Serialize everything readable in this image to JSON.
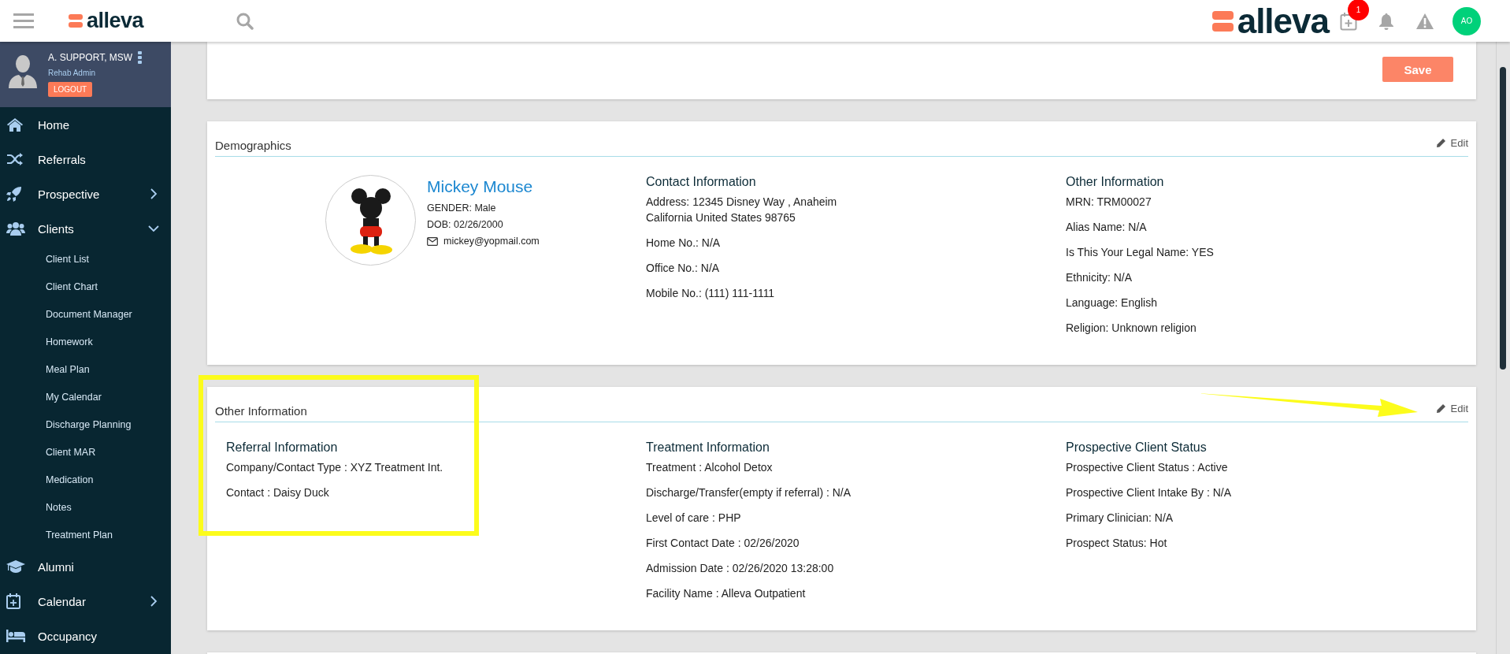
{
  "header": {
    "logo": "alleva",
    "brand_logo": "alleva",
    "notification_count": "1",
    "avatar_initials": "AO"
  },
  "user": {
    "name": "A. SUPPORT, MSW",
    "role": "Rehab Admin",
    "logout": "LOGOUT"
  },
  "sidebar": {
    "items": [
      {
        "label": "Home",
        "kind": "link"
      },
      {
        "label": "Referrals",
        "kind": "link"
      },
      {
        "label": "Prospective",
        "kind": "group",
        "expanded": false
      },
      {
        "label": "Clients",
        "kind": "group",
        "expanded": true,
        "children": [
          {
            "label": "Client List"
          },
          {
            "label": "Client Chart"
          },
          {
            "label": "Document Manager"
          },
          {
            "label": "Homework"
          },
          {
            "label": "Meal Plan"
          },
          {
            "label": "My Calendar"
          },
          {
            "label": "Discharge Planning"
          },
          {
            "label": "Client MAR"
          },
          {
            "label": "Medication"
          },
          {
            "label": "Notes"
          },
          {
            "label": "Treatment Plan"
          }
        ]
      },
      {
        "label": "Alumni",
        "kind": "link"
      },
      {
        "label": "Calendar",
        "kind": "group",
        "expanded": false
      },
      {
        "label": "Occupancy",
        "kind": "link"
      }
    ]
  },
  "save_button": "Save",
  "demographics": {
    "title": "Demographics",
    "edit": "Edit",
    "client": {
      "name": "Mickey Mouse",
      "gender": "GENDER: Male",
      "dob": "DOB: 02/26/2000",
      "email": "mickey@yopmail.com"
    },
    "columns": [
      {
        "heading": "Contact Information",
        "fields": [
          [
            "Address: 12345 Disney Way , Anaheim",
            "California United States 98765"
          ],
          [
            "Home No.: N/A"
          ],
          [
            "Office No.: N/A"
          ],
          [
            "Mobile No.: (111) 111-1111"
          ]
        ]
      },
      {
        "heading": "Other Information",
        "fields": [
          [
            "MRN: TRM00027"
          ],
          [
            "Alias Name: N/A"
          ],
          [
            "Is This Your Legal Name: YES"
          ],
          [
            "Ethnicity: N/A"
          ],
          [
            "Language: English"
          ],
          [
            "Religion: Unknown religion"
          ]
        ]
      }
    ]
  },
  "other_information": {
    "title": "Other Information",
    "edit": "Edit",
    "columns": [
      {
        "heading": "Referral Information",
        "fields": [
          "Company/Contact Type : XYZ Treatment Int.",
          "Contact : Daisy Duck"
        ]
      },
      {
        "heading": "Treatment Information",
        "fields": [
          "Treatment : Alcohol Detox",
          "Discharge/Transfer(empty if referral) : N/A",
          "Level of care : PHP",
          "First Contact Date : 02/26/2020",
          "Admission Date : 02/26/2020 13:28:00",
          "Facility Name : Alleva Outpatient"
        ]
      },
      {
        "heading": "Prospective Client Status",
        "fields": [
          "Prospective Client Status : Active",
          "Prospective Client Intake By : N/A",
          "Primary Clinician: N/A",
          "Prospect Status: Hot"
        ]
      }
    ]
  }
}
